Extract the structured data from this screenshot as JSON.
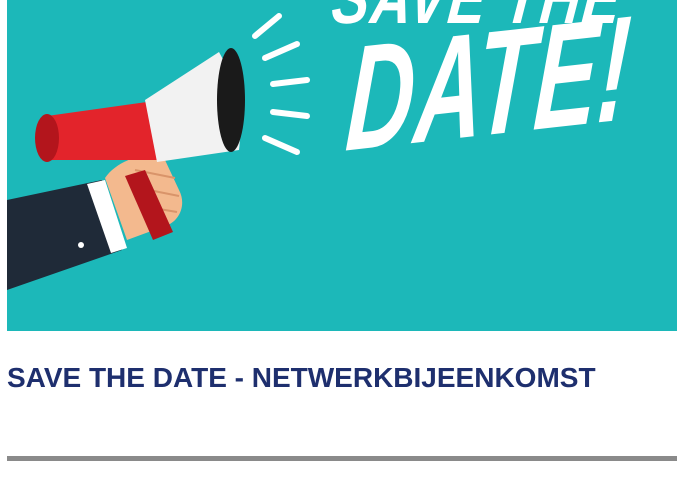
{
  "banner": {
    "headline_top": "SAVE THE",
    "headline_main": "DATE!",
    "background_color": "#1cb8b9",
    "icon": "megaphone-icon"
  },
  "title": "SAVE THE DATE - NETWERKBIJEENKOMST",
  "colors": {
    "title": "#1e2f6e",
    "divider": "#8a8a8a",
    "megaphone_red": "#e3242b",
    "megaphone_white": "#f2f2f2",
    "sleeve": "#1f2a38",
    "skin": "#f3b98e"
  }
}
